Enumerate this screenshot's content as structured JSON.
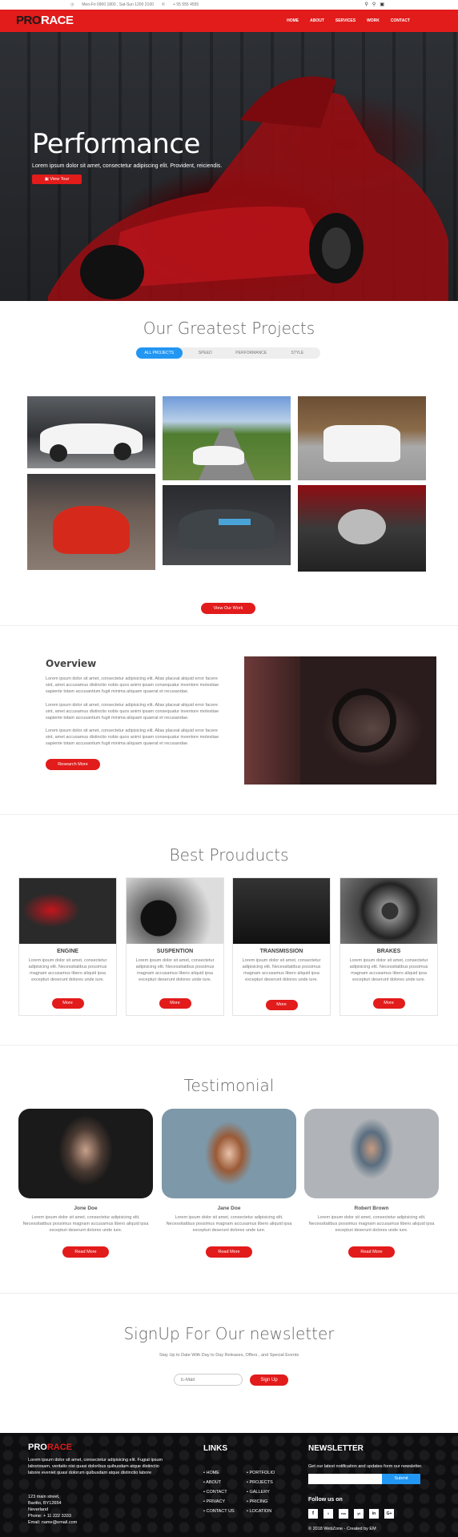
{
  "topbar": {
    "hours": "Mon-Fri 0900 1800 , Sat-Sun 1200 2100",
    "phone": "+ 55 555 4555"
  },
  "brand": {
    "part1": "PRO",
    "part2": "RACE"
  },
  "nav": [
    "HOME",
    "ABOUT",
    "SERVICES",
    "WORK",
    "CONTACT"
  ],
  "hero": {
    "title": "Performance",
    "subtitle": "Lorem ipsum dolor sit amet, consectetur adipiscing elit. Provident, reiciendis.",
    "button": "View Tour"
  },
  "projects": {
    "title": "Our Greatest Projects",
    "tabs": [
      "ALL PROJECTS",
      "SPEED",
      "PERFORMANCE",
      "STYLE"
    ],
    "button": "View Our Work"
  },
  "overview": {
    "title": "Overview",
    "paragraphs": [
      "Lorem ipsum dolor sit amet, consectetur adipisicing elit. Alias placeat aliquid error facere sint, amet accusamus distinctio nobis quos animi ipsam consequatur inventore molestiae sapiente totam accusantium fugit minima aliquam quaerat et recusandae.",
      "Lorem ipsum dolor sit amet, consectetur adipisicing elit. Alias placeat aliquid error facere sint, amet accusamus distinctio nobis quos animi ipsam consequatur inventore molestiae sapiente totam accusantium fugit minima aliquam quaerat et recusandae.",
      "Lorem ipsum dolor sit amet, consectetur adipisicing elit. Alias placeat aliquid error facere sint, amet accusamus distinctio nobis quos animi ipsam consequatur inventore molestiae sapiente totam accusantium fugit minima aliquam quaerat et recusandae."
    ],
    "button": "Research More"
  },
  "products": {
    "title": "Best Prouducts",
    "items": [
      {
        "name": "ENGINE",
        "text": "Lorem ipsum dolor sit amet, consectetur adipisicing elit. Necessitatibus possimus magnam accusamus libero aliquid ipsa excepturi deserunt dolores unde iure.",
        "button": "More"
      },
      {
        "name": "SUSPENTION",
        "text": "Lorem ipsum dolor sit amet, consectetur adipisicing elit. Necessitatibus possimus magnam accusamus libero aliquid ipsa excepturi deserunt dolores unde iure.",
        "button": "More"
      },
      {
        "name": "TRANSMISSION",
        "text": "Lorem ipsum dolor sit amet, consectetur adipisicing elit. Necessitatibus possimus magnam accusamus libero aliquid ipsa excepturi deserunt dolores unde iure.",
        "button": "More"
      },
      {
        "name": "BRAKES",
        "text": "Lorem ipsum dolor sit amet, consectetur adipisicing elit. Necessitatibus possimus magnam accusamus libero aliquid ipsa excepturi deserunt dolores unde iure.",
        "button": "More"
      }
    ]
  },
  "testimonial": {
    "title": "Testimonial",
    "people": [
      {
        "name": "Jone Doe",
        "text": "Lorem ipsum dolor sit amet, consectetur adipisicing elit. Necessitatibus possimus magnam accusamus libero aliquid ipsa excepturi deserunt dolores unde iure.",
        "button": "Read More"
      },
      {
        "name": "Jane Doe",
        "text": "Lorem ipsum dolor sit amet, consectetur adipisicing elit. Necessitatibus possimus magnam accusamus libero aliquid ipsa excepturi deserunt dolores unde iure.",
        "button": "Read More"
      },
      {
        "name": "Robert Brown",
        "text": "Lorem ipsum dolor sit amet, consectetur adipisicing elit. Necessitatibus possimus magnam accusamus libero aliquid ipsa excepturi deserunt dolores unde iure.",
        "button": "Read More"
      }
    ]
  },
  "newsletter": {
    "title": "SignUp For Our newsletter",
    "subtitle": "Stay Up to Date With Day to Day Releases, Offers , and Special Events",
    "placeholder": "E-Mail",
    "button": "Sign Up"
  },
  "footer": {
    "about": "Lorem ipsum dolor sit amet, consectetur adipisicing elit. Fugiat ipsum laboriosam, veritatis nisi quasi doloribus quibusdam atque distinctio labore eveniet quasi dolorum quibusdam atque distinctio labore",
    "address": [
      "123 main street,",
      "Baritto, BY12654",
      "Neverland"
    ],
    "phone": "Phone: + 11 222 3333",
    "email": "Email: name@email.com",
    "links_title": "LINKS",
    "links_col1": [
      "HOME",
      "ABOUT",
      "CONTACT",
      "PRIVACY",
      "CONTACT US"
    ],
    "links_col2": [
      "PORTFOLIO",
      "PROJECTS",
      "GALLERY",
      "PRICING",
      "LOCATION"
    ],
    "news_title": "NEWSLETTER",
    "news_text": "Get our latest notification and updates form our newsletter.",
    "submit": "Submit",
    "follow": "Follow us on",
    "social": [
      "f",
      "t",
      "rss",
      "yt",
      "in",
      "G+"
    ],
    "copyright": "© 2018 WebZone - Created by EM"
  }
}
